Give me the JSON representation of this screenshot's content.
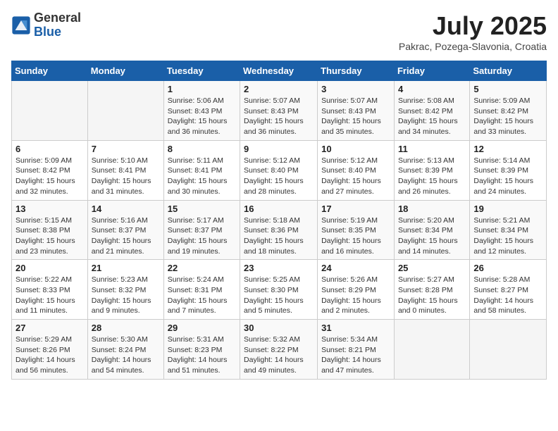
{
  "header": {
    "logo": {
      "general": "General",
      "blue": "Blue"
    },
    "title": "July 2025",
    "location": "Pakrac, Pozega-Slavonia, Croatia"
  },
  "calendar": {
    "days_of_week": [
      "Sunday",
      "Monday",
      "Tuesday",
      "Wednesday",
      "Thursday",
      "Friday",
      "Saturday"
    ],
    "weeks": [
      [
        {
          "day": "",
          "info": ""
        },
        {
          "day": "",
          "info": ""
        },
        {
          "day": "1",
          "info": "Sunrise: 5:06 AM\nSunset: 8:43 PM\nDaylight: 15 hours and 36 minutes."
        },
        {
          "day": "2",
          "info": "Sunrise: 5:07 AM\nSunset: 8:43 PM\nDaylight: 15 hours and 36 minutes."
        },
        {
          "day": "3",
          "info": "Sunrise: 5:07 AM\nSunset: 8:43 PM\nDaylight: 15 hours and 35 minutes."
        },
        {
          "day": "4",
          "info": "Sunrise: 5:08 AM\nSunset: 8:42 PM\nDaylight: 15 hours and 34 minutes."
        },
        {
          "day": "5",
          "info": "Sunrise: 5:09 AM\nSunset: 8:42 PM\nDaylight: 15 hours and 33 minutes."
        }
      ],
      [
        {
          "day": "6",
          "info": "Sunrise: 5:09 AM\nSunset: 8:42 PM\nDaylight: 15 hours and 32 minutes."
        },
        {
          "day": "7",
          "info": "Sunrise: 5:10 AM\nSunset: 8:41 PM\nDaylight: 15 hours and 31 minutes."
        },
        {
          "day": "8",
          "info": "Sunrise: 5:11 AM\nSunset: 8:41 PM\nDaylight: 15 hours and 30 minutes."
        },
        {
          "day": "9",
          "info": "Sunrise: 5:12 AM\nSunset: 8:40 PM\nDaylight: 15 hours and 28 minutes."
        },
        {
          "day": "10",
          "info": "Sunrise: 5:12 AM\nSunset: 8:40 PM\nDaylight: 15 hours and 27 minutes."
        },
        {
          "day": "11",
          "info": "Sunrise: 5:13 AM\nSunset: 8:39 PM\nDaylight: 15 hours and 26 minutes."
        },
        {
          "day": "12",
          "info": "Sunrise: 5:14 AM\nSunset: 8:39 PM\nDaylight: 15 hours and 24 minutes."
        }
      ],
      [
        {
          "day": "13",
          "info": "Sunrise: 5:15 AM\nSunset: 8:38 PM\nDaylight: 15 hours and 23 minutes."
        },
        {
          "day": "14",
          "info": "Sunrise: 5:16 AM\nSunset: 8:37 PM\nDaylight: 15 hours and 21 minutes."
        },
        {
          "day": "15",
          "info": "Sunrise: 5:17 AM\nSunset: 8:37 PM\nDaylight: 15 hours and 19 minutes."
        },
        {
          "day": "16",
          "info": "Sunrise: 5:18 AM\nSunset: 8:36 PM\nDaylight: 15 hours and 18 minutes."
        },
        {
          "day": "17",
          "info": "Sunrise: 5:19 AM\nSunset: 8:35 PM\nDaylight: 15 hours and 16 minutes."
        },
        {
          "day": "18",
          "info": "Sunrise: 5:20 AM\nSunset: 8:34 PM\nDaylight: 15 hours and 14 minutes."
        },
        {
          "day": "19",
          "info": "Sunrise: 5:21 AM\nSunset: 8:34 PM\nDaylight: 15 hours and 12 minutes."
        }
      ],
      [
        {
          "day": "20",
          "info": "Sunrise: 5:22 AM\nSunset: 8:33 PM\nDaylight: 15 hours and 11 minutes."
        },
        {
          "day": "21",
          "info": "Sunrise: 5:23 AM\nSunset: 8:32 PM\nDaylight: 15 hours and 9 minutes."
        },
        {
          "day": "22",
          "info": "Sunrise: 5:24 AM\nSunset: 8:31 PM\nDaylight: 15 hours and 7 minutes."
        },
        {
          "day": "23",
          "info": "Sunrise: 5:25 AM\nSunset: 8:30 PM\nDaylight: 15 hours and 5 minutes."
        },
        {
          "day": "24",
          "info": "Sunrise: 5:26 AM\nSunset: 8:29 PM\nDaylight: 15 hours and 2 minutes."
        },
        {
          "day": "25",
          "info": "Sunrise: 5:27 AM\nSunset: 8:28 PM\nDaylight: 15 hours and 0 minutes."
        },
        {
          "day": "26",
          "info": "Sunrise: 5:28 AM\nSunset: 8:27 PM\nDaylight: 14 hours and 58 minutes."
        }
      ],
      [
        {
          "day": "27",
          "info": "Sunrise: 5:29 AM\nSunset: 8:26 PM\nDaylight: 14 hours and 56 minutes."
        },
        {
          "day": "28",
          "info": "Sunrise: 5:30 AM\nSunset: 8:24 PM\nDaylight: 14 hours and 54 minutes."
        },
        {
          "day": "29",
          "info": "Sunrise: 5:31 AM\nSunset: 8:23 PM\nDaylight: 14 hours and 51 minutes."
        },
        {
          "day": "30",
          "info": "Sunrise: 5:32 AM\nSunset: 8:22 PM\nDaylight: 14 hours and 49 minutes."
        },
        {
          "day": "31",
          "info": "Sunrise: 5:34 AM\nSunset: 8:21 PM\nDaylight: 14 hours and 47 minutes."
        },
        {
          "day": "",
          "info": ""
        },
        {
          "day": "",
          "info": ""
        }
      ]
    ]
  }
}
